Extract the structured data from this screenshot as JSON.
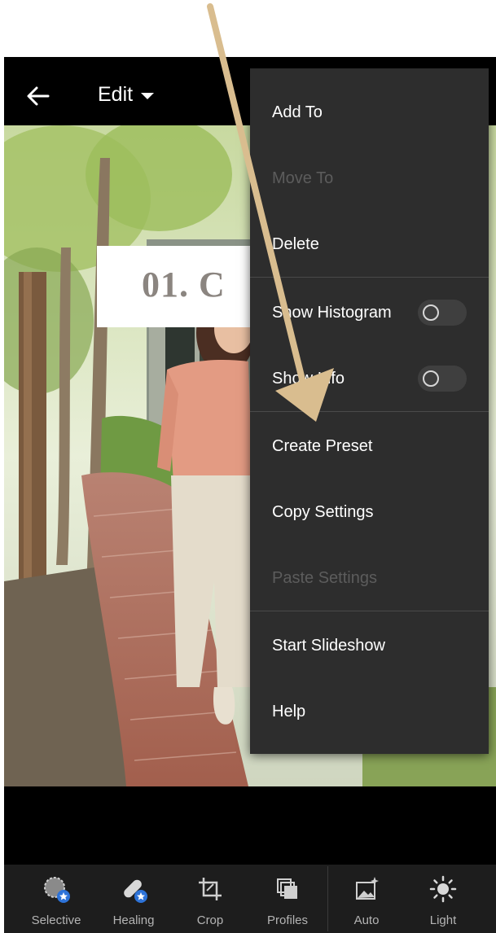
{
  "topbar": {
    "title": "Edit",
    "back_icon": "arrow-left-icon"
  },
  "photo": {
    "title_card_text": "01. C"
  },
  "menu": {
    "items": [
      {
        "label": "Add To",
        "enabled": true
      },
      {
        "label": "Move To",
        "enabled": false
      },
      {
        "label": "Delete",
        "enabled": true
      },
      {
        "label": "Show Histogram",
        "enabled": true,
        "toggle": false
      },
      {
        "label": "Show Info",
        "enabled": true,
        "toggle": false
      },
      {
        "label": "Create Preset",
        "enabled": true
      },
      {
        "label": "Copy Settings",
        "enabled": true
      },
      {
        "label": "Paste Settings",
        "enabled": false
      },
      {
        "label": "Start Slideshow",
        "enabled": true
      },
      {
        "label": "Help",
        "enabled": true
      }
    ]
  },
  "toolbar": {
    "tools": [
      {
        "label": "Selective",
        "icon": "selective-icon"
      },
      {
        "label": "Healing",
        "icon": "healing-icon"
      },
      {
        "label": "Crop",
        "icon": "crop-icon"
      },
      {
        "label": "Profiles",
        "icon": "profiles-icon"
      },
      {
        "label": "Auto",
        "icon": "auto-icon"
      },
      {
        "label": "Light",
        "icon": "light-icon"
      }
    ]
  },
  "colors": {
    "menu_bg": "#2d2d2d",
    "accent_blue": "#2d73d9",
    "annotation_arrow": "#d9bd8f"
  }
}
